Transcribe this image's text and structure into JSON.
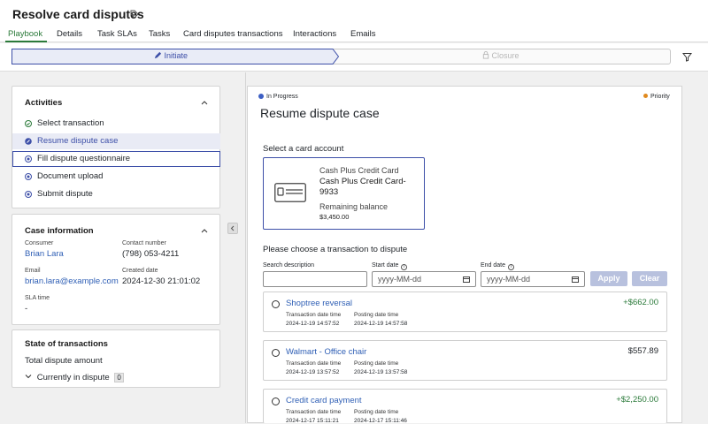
{
  "header": {
    "title": "Resolve card disputes",
    "title_icon": "tag-icon"
  },
  "tabs": [
    {
      "label": "Playbook",
      "active": true
    },
    {
      "label": "Details"
    },
    {
      "label": "Task SLAs"
    },
    {
      "label": "Tasks"
    },
    {
      "label": "Card disputes transactions"
    },
    {
      "label": "Interactions"
    },
    {
      "label": "Emails"
    }
  ],
  "stages": {
    "initiate": "Initiate",
    "closure": "Closure"
  },
  "activities": {
    "title": "Activities",
    "items": [
      {
        "label": "Select transaction",
        "status": "completed"
      },
      {
        "label": "Resume dispute case",
        "status": "in-progress"
      },
      {
        "label": "Fill dispute questionnaire",
        "status": "pending"
      },
      {
        "label": "Document upload",
        "status": "pending"
      },
      {
        "label": "Submit dispute",
        "status": "pending"
      }
    ]
  },
  "case_info": {
    "title": "Case information",
    "consumer_label": "Consumer",
    "consumer": "Brian Lara",
    "contact_label": "Contact number",
    "contact": "(798) 053-4211",
    "email_label": "Email",
    "email": "brian.lara@example.com",
    "created_label": "Created date",
    "created": "2024-12-30 21:01:02",
    "sla_label": "SLA time",
    "sla": "-"
  },
  "state": {
    "title": "State of transactions",
    "total_label": "Total dispute amount",
    "current_label": "Currently in dispute",
    "current_count": "0"
  },
  "task": {
    "status": "In Progress",
    "priority": "Priority",
    "title": "Resume dispute case",
    "select_account": "Select a card account",
    "account": {
      "type": "Cash Plus Credit Card",
      "name": "Cash Plus Credit Card-9933",
      "balance_label": "Remaining balance",
      "balance": "$3,450.00"
    },
    "choose_txn": "Please choose a transaction to dispute",
    "search_label": "Search description",
    "start_label": "Start date",
    "end_label": "End date",
    "date_placeholder": "yyyy-MM-dd",
    "apply": "Apply",
    "clear": "Clear"
  },
  "transactions": [
    {
      "name": "Shoptree reversal",
      "amount": "+$662.00",
      "credit": true,
      "txn_label": "Transaction date time",
      "txn_date": "2024-12-19 14:57:52",
      "post_label": "Posting date time",
      "post_date": "2024-12-19 14:57:58"
    },
    {
      "name": "Walmart - Office chair",
      "amount": "$557.89",
      "credit": false,
      "txn_label": "Transaction date time",
      "txn_date": "2024-12-19 13:57:52",
      "post_label": "Posting date time",
      "post_date": "2024-12-19 13:57:58"
    },
    {
      "name": "Credit card payment",
      "amount": "+$2,250.00",
      "credit": true,
      "txn_label": "Transaction date time",
      "txn_date": "2024-12-17 15:11:21",
      "post_label": "Posting date time",
      "post_date": "2024-12-17 15:11:46"
    }
  ],
  "colors": {
    "accent": "#3d4fa8",
    "tab_active": "#2b7a3a",
    "credit": "#2b7a3a",
    "link": "#2f5fb5"
  }
}
